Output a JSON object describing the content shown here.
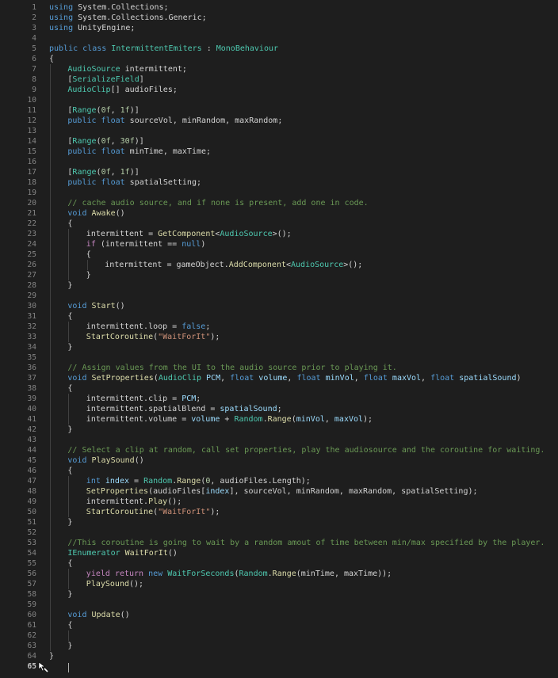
{
  "editor": {
    "active_line": 65,
    "lines": [
      {
        "n": "1",
        "indent": 0,
        "t": [
          [
            "kw",
            "using"
          ],
          [
            "pl",
            " System.Collections;"
          ]
        ]
      },
      {
        "n": "2",
        "indent": 0,
        "t": [
          [
            "kw",
            "using"
          ],
          [
            "pl",
            " System.Collections.Generic;"
          ]
        ]
      },
      {
        "n": "3",
        "indent": 0,
        "t": [
          [
            "kw",
            "using"
          ],
          [
            "pl",
            " UnityEngine;"
          ]
        ]
      },
      {
        "n": "4",
        "indent": 0,
        "t": []
      },
      {
        "n": "5",
        "indent": 0,
        "t": [
          [
            "kw",
            "public"
          ],
          [
            "pl",
            " "
          ],
          [
            "kw",
            "class"
          ],
          [
            "pl",
            " "
          ],
          [
            "ty",
            "IntermittentEmiters"
          ],
          [
            "pl",
            " : "
          ],
          [
            "ty",
            "MonoBehaviour"
          ]
        ]
      },
      {
        "n": "6",
        "indent": 0,
        "t": [
          [
            "pl",
            "{"
          ]
        ]
      },
      {
        "n": "7",
        "indent": 1,
        "t": [
          [
            "ty",
            "AudioSource"
          ],
          [
            "pl",
            " intermittent;"
          ]
        ]
      },
      {
        "n": "8",
        "indent": 1,
        "t": [
          [
            "pl",
            "["
          ],
          [
            "ty",
            "SerializeField"
          ],
          [
            "pl",
            "]"
          ]
        ]
      },
      {
        "n": "9",
        "indent": 1,
        "t": [
          [
            "ty",
            "AudioClip"
          ],
          [
            "pl",
            "[] audioFiles;"
          ]
        ]
      },
      {
        "n": "10",
        "indent": 1,
        "t": []
      },
      {
        "n": "11",
        "indent": 1,
        "t": [
          [
            "pl",
            "["
          ],
          [
            "ty",
            "Range"
          ],
          [
            "pl",
            "("
          ],
          [
            "num",
            "0f"
          ],
          [
            "pl",
            ", "
          ],
          [
            "num",
            "1f"
          ],
          [
            "pl",
            ")]"
          ]
        ]
      },
      {
        "n": "12",
        "indent": 1,
        "t": [
          [
            "kw",
            "public"
          ],
          [
            "pl",
            " "
          ],
          [
            "kw",
            "float"
          ],
          [
            "pl",
            " sourceVol, minRandom, maxRandom;"
          ]
        ]
      },
      {
        "n": "13",
        "indent": 1,
        "t": []
      },
      {
        "n": "14",
        "indent": 1,
        "t": [
          [
            "pl",
            "["
          ],
          [
            "ty",
            "Range"
          ],
          [
            "pl",
            "("
          ],
          [
            "num",
            "0f"
          ],
          [
            "pl",
            ", "
          ],
          [
            "num",
            "30f"
          ],
          [
            "pl",
            ")]"
          ]
        ]
      },
      {
        "n": "15",
        "indent": 1,
        "t": [
          [
            "kw",
            "public"
          ],
          [
            "pl",
            " "
          ],
          [
            "kw",
            "float"
          ],
          [
            "pl",
            " minTime, maxTime;"
          ]
        ]
      },
      {
        "n": "16",
        "indent": 1,
        "t": []
      },
      {
        "n": "17",
        "indent": 1,
        "t": [
          [
            "pl",
            "["
          ],
          [
            "ty",
            "Range"
          ],
          [
            "pl",
            "("
          ],
          [
            "num",
            "0f"
          ],
          [
            "pl",
            ", "
          ],
          [
            "num",
            "1f"
          ],
          [
            "pl",
            ")]"
          ]
        ]
      },
      {
        "n": "18",
        "indent": 1,
        "t": [
          [
            "kw",
            "public"
          ],
          [
            "pl",
            " "
          ],
          [
            "kw",
            "float"
          ],
          [
            "pl",
            " spatialSetting;"
          ]
        ]
      },
      {
        "n": "19",
        "indent": 1,
        "t": []
      },
      {
        "n": "20",
        "indent": 1,
        "t": [
          [
            "cm",
            "// cache audio source, and if none is present, add one in code."
          ]
        ]
      },
      {
        "n": "21",
        "indent": 1,
        "t": [
          [
            "kw",
            "void"
          ],
          [
            "pl",
            " "
          ],
          [
            "fn",
            "Awake"
          ],
          [
            "pl",
            "()"
          ]
        ]
      },
      {
        "n": "22",
        "indent": 1,
        "t": [
          [
            "pl",
            "{"
          ]
        ]
      },
      {
        "n": "23",
        "indent": 2,
        "t": [
          [
            "pl",
            "intermittent = "
          ],
          [
            "fn",
            "GetComponent"
          ],
          [
            "pl",
            "<"
          ],
          [
            "ty",
            "AudioSource"
          ],
          [
            "pl",
            ">();"
          ]
        ]
      },
      {
        "n": "24",
        "indent": 2,
        "t": [
          [
            "ctl",
            "if"
          ],
          [
            "pl",
            " (intermittent == "
          ],
          [
            "kw",
            "null"
          ],
          [
            "pl",
            ")"
          ]
        ]
      },
      {
        "n": "25",
        "indent": 2,
        "t": [
          [
            "pl",
            "{"
          ]
        ]
      },
      {
        "n": "26",
        "indent": 3,
        "t": [
          [
            "pl",
            "intermittent = gameObject."
          ],
          [
            "fn",
            "AddComponent"
          ],
          [
            "pl",
            "<"
          ],
          [
            "ty",
            "AudioSource"
          ],
          [
            "pl",
            ">();"
          ]
        ]
      },
      {
        "n": "27",
        "indent": 2,
        "t": [
          [
            "pl",
            "}"
          ]
        ]
      },
      {
        "n": "28",
        "indent": 1,
        "t": [
          [
            "pl",
            "}"
          ]
        ]
      },
      {
        "n": "29",
        "indent": 1,
        "t": []
      },
      {
        "n": "30",
        "indent": 1,
        "t": [
          [
            "kw",
            "void"
          ],
          [
            "pl",
            " "
          ],
          [
            "fn",
            "Start"
          ],
          [
            "pl",
            "()"
          ]
        ]
      },
      {
        "n": "31",
        "indent": 1,
        "t": [
          [
            "pl",
            "{"
          ]
        ]
      },
      {
        "n": "32",
        "indent": 2,
        "t": [
          [
            "pl",
            "intermittent.loop = "
          ],
          [
            "kw",
            "false"
          ],
          [
            "pl",
            ";"
          ]
        ]
      },
      {
        "n": "33",
        "indent": 2,
        "t": [
          [
            "fn",
            "StartCoroutine"
          ],
          [
            "pl",
            "("
          ],
          [
            "str",
            "\"WaitForIt\""
          ],
          [
            "pl",
            ");"
          ]
        ]
      },
      {
        "n": "34",
        "indent": 1,
        "t": [
          [
            "pl",
            "}"
          ]
        ]
      },
      {
        "n": "35",
        "indent": 1,
        "t": []
      },
      {
        "n": "36",
        "indent": 1,
        "t": [
          [
            "cm",
            "// Assign values from the UI to the audio source prior to playing it."
          ]
        ]
      },
      {
        "n": "37",
        "indent": 1,
        "t": [
          [
            "kw",
            "void"
          ],
          [
            "pl",
            " "
          ],
          [
            "fn",
            "SetProperties"
          ],
          [
            "pl",
            "("
          ],
          [
            "ty",
            "AudioClip"
          ],
          [
            "pl",
            " "
          ],
          [
            "var",
            "PCM"
          ],
          [
            "pl",
            ", "
          ],
          [
            "kw",
            "float"
          ],
          [
            "pl",
            " "
          ],
          [
            "var",
            "volume"
          ],
          [
            "pl",
            ", "
          ],
          [
            "kw",
            "float"
          ],
          [
            "pl",
            " "
          ],
          [
            "var",
            "minVol"
          ],
          [
            "pl",
            ", "
          ],
          [
            "kw",
            "float"
          ],
          [
            "pl",
            " "
          ],
          [
            "var",
            "maxVol"
          ],
          [
            "pl",
            ", "
          ],
          [
            "kw",
            "float"
          ],
          [
            "pl",
            " "
          ],
          [
            "var",
            "spatialSound"
          ],
          [
            "pl",
            ")"
          ]
        ]
      },
      {
        "n": "38",
        "indent": 1,
        "t": [
          [
            "pl",
            "{"
          ]
        ]
      },
      {
        "n": "39",
        "indent": 2,
        "t": [
          [
            "pl",
            "intermittent.clip = "
          ],
          [
            "var",
            "PCM"
          ],
          [
            "pl",
            ";"
          ]
        ]
      },
      {
        "n": "40",
        "indent": 2,
        "t": [
          [
            "pl",
            "intermittent.spatialBlend = "
          ],
          [
            "var",
            "spatialSound"
          ],
          [
            "pl",
            ";"
          ]
        ]
      },
      {
        "n": "41",
        "indent": 2,
        "t": [
          [
            "pl",
            "intermittent.volume = "
          ],
          [
            "var",
            "volume"
          ],
          [
            "pl",
            " + "
          ],
          [
            "ty",
            "Random"
          ],
          [
            "pl",
            "."
          ],
          [
            "fn",
            "Range"
          ],
          [
            "pl",
            "("
          ],
          [
            "var",
            "minVol"
          ],
          [
            "pl",
            ", "
          ],
          [
            "var",
            "maxVol"
          ],
          [
            "pl",
            ");"
          ]
        ]
      },
      {
        "n": "42",
        "indent": 1,
        "t": [
          [
            "pl",
            "}"
          ]
        ]
      },
      {
        "n": "43",
        "indent": 1,
        "t": []
      },
      {
        "n": "44",
        "indent": 1,
        "t": [
          [
            "cm",
            "// Select a clip at random, call set properties, play the audiosource and the coroutine for waiting."
          ]
        ]
      },
      {
        "n": "45",
        "indent": 1,
        "t": [
          [
            "kw",
            "void"
          ],
          [
            "pl",
            " "
          ],
          [
            "fn",
            "PlaySound"
          ],
          [
            "pl",
            "()"
          ]
        ]
      },
      {
        "n": "46",
        "indent": 1,
        "t": [
          [
            "pl",
            "{"
          ]
        ]
      },
      {
        "n": "47",
        "indent": 2,
        "t": [
          [
            "kw",
            "int"
          ],
          [
            "pl",
            " "
          ],
          [
            "var",
            "index"
          ],
          [
            "pl",
            " = "
          ],
          [
            "ty",
            "Random"
          ],
          [
            "pl",
            "."
          ],
          [
            "fn",
            "Range"
          ],
          [
            "pl",
            "("
          ],
          [
            "num",
            "0"
          ],
          [
            "pl",
            ", audioFiles.Length);"
          ]
        ]
      },
      {
        "n": "48",
        "indent": 2,
        "t": [
          [
            "fn",
            "SetProperties"
          ],
          [
            "pl",
            "(audioFiles["
          ],
          [
            "var",
            "index"
          ],
          [
            "pl",
            "], sourceVol, minRandom, maxRandom, spatialSetting);"
          ]
        ]
      },
      {
        "n": "49",
        "indent": 2,
        "t": [
          [
            "pl",
            "intermittent."
          ],
          [
            "fn",
            "Play"
          ],
          [
            "pl",
            "();"
          ]
        ]
      },
      {
        "n": "50",
        "indent": 2,
        "t": [
          [
            "fn",
            "StartCoroutine"
          ],
          [
            "pl",
            "("
          ],
          [
            "str",
            "\"WaitForIt\""
          ],
          [
            "pl",
            ");"
          ]
        ]
      },
      {
        "n": "51",
        "indent": 1,
        "t": [
          [
            "pl",
            "}"
          ]
        ]
      },
      {
        "n": "52",
        "indent": 1,
        "t": []
      },
      {
        "n": "53",
        "indent": 1,
        "t": [
          [
            "cm",
            "//This coroutine is going to wait by a random amout of time between min/max specified by the player."
          ]
        ]
      },
      {
        "n": "54",
        "indent": 1,
        "t": [
          [
            "ty",
            "IEnumerator"
          ],
          [
            "pl",
            " "
          ],
          [
            "fn",
            "WaitForIt"
          ],
          [
            "pl",
            "()"
          ]
        ]
      },
      {
        "n": "55",
        "indent": 1,
        "t": [
          [
            "pl",
            "{"
          ]
        ]
      },
      {
        "n": "56",
        "indent": 2,
        "t": [
          [
            "ctl",
            "yield"
          ],
          [
            "pl",
            " "
          ],
          [
            "ctl",
            "return"
          ],
          [
            "pl",
            " "
          ],
          [
            "kw",
            "new"
          ],
          [
            "pl",
            " "
          ],
          [
            "ty",
            "WaitForSeconds"
          ],
          [
            "pl",
            "("
          ],
          [
            "ty",
            "Random"
          ],
          [
            "pl",
            "."
          ],
          [
            "fn",
            "Range"
          ],
          [
            "pl",
            "(minTime, maxTime));"
          ]
        ]
      },
      {
        "n": "57",
        "indent": 2,
        "t": [
          [
            "fn",
            "PlaySound"
          ],
          [
            "pl",
            "();"
          ]
        ]
      },
      {
        "n": "58",
        "indent": 1,
        "t": [
          [
            "pl",
            "}"
          ]
        ]
      },
      {
        "n": "59",
        "indent": 1,
        "t": []
      },
      {
        "n": "60",
        "indent": 1,
        "t": [
          [
            "kw",
            "void"
          ],
          [
            "pl",
            " "
          ],
          [
            "fn",
            "Update"
          ],
          [
            "pl",
            "()"
          ]
        ]
      },
      {
        "n": "61",
        "indent": 1,
        "t": [
          [
            "pl",
            "{"
          ]
        ]
      },
      {
        "n": "62",
        "indent": 2,
        "t": []
      },
      {
        "n": "63",
        "indent": 1,
        "t": [
          [
            "pl",
            "}"
          ]
        ]
      },
      {
        "n": "64",
        "indent": 0,
        "t": [
          [
            "pl",
            "}"
          ]
        ]
      },
      {
        "n": "65",
        "indent": 0,
        "t": []
      }
    ]
  },
  "colors": {
    "background": "#1e1e1e",
    "keyword": "#569cd6",
    "control": "#c586c0",
    "type": "#4ec9b0",
    "function": "#dcdcaa",
    "string": "#ce9178",
    "number": "#b5cea8",
    "comment": "#6a9955",
    "parameter": "#9cdcfe",
    "line_number": "#858585"
  },
  "icons": {
    "cursor": "pencil-cursor-icon"
  }
}
